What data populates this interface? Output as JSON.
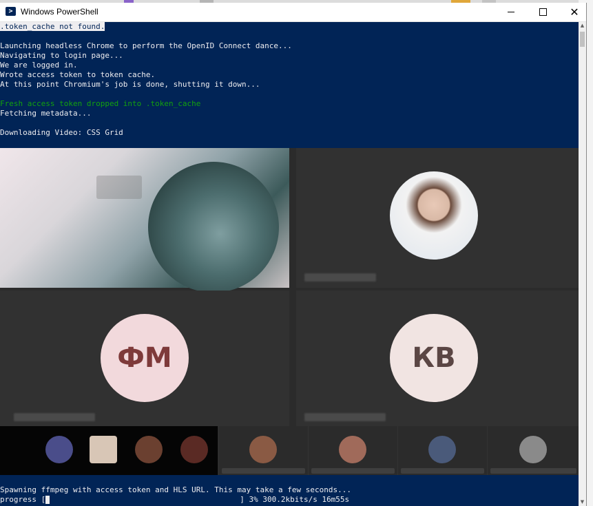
{
  "window": {
    "title": "Windows PowerShell",
    "icon": "powershell-icon",
    "controls": [
      "minimize-icon",
      "maximize-icon",
      "close-icon"
    ]
  },
  "console": {
    "background": "#012456",
    "lines": [
      ".token_cache not found.",
      "Launching headless Chrome to perform the OpenID Connect dance...",
      "Navigating to login page...",
      "We are logged in.",
      "Wrote access token to token cache.",
      "At this point Chromium's job is done, shutting it down...",
      "Fresh access token dropped into .token_cache",
      "Fetching metadata...",
      "Downloading Video: CSS Grid",
      "Spawning ffmpeg with access token and HLS URL. This may take a few seconds...",
      "progress [",
      "] 3% 300.2kbits/s 16m55s"
    ],
    "colors": {
      "text": "#eeedf0",
      "success": "#13a10e"
    }
  },
  "video": {
    "participants": [
      {
        "type": "camera"
      },
      {
        "type": "photo-avatar"
      },
      {
        "type": "initials",
        "initials": "ФМ"
      },
      {
        "type": "initials",
        "initials": "КВ"
      }
    ],
    "progress_percent": 3
  }
}
